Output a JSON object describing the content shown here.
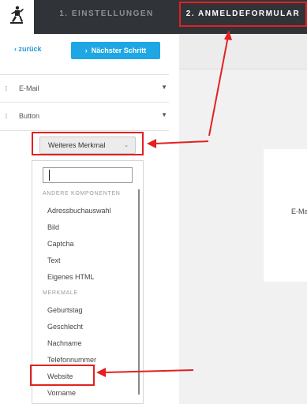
{
  "colors": {
    "accent": "#1ea7e4",
    "topbar": "#303439",
    "annotation": "#e32020"
  },
  "header": {
    "logo_icon": "running-man-icon",
    "tabs": [
      {
        "label": "1. EINSTELLUNGEN"
      },
      {
        "label": "2. ANMELDEFORMULAR",
        "active": true
      }
    ]
  },
  "panel": {
    "back_label": "zurück",
    "next_label": "Nächster Schritt",
    "fields": [
      {
        "label": "E-Mail"
      },
      {
        "label": "Button"
      }
    ],
    "add_button_label": "Weiteres Merkmal",
    "dropdown": {
      "search_value": "",
      "sections": [
        {
          "title": "ANDERE KOMPONENTEN",
          "items": [
            "Adressbuchauswahl",
            "Bild",
            "Captcha",
            "Text",
            "Eigenes HTML"
          ]
        },
        {
          "title": "MERKMALE",
          "items": [
            "Geburtstag",
            "Geschlecht",
            "Nachname",
            "Telefonnummer",
            "Website",
            "Vorname"
          ]
        }
      ]
    }
  },
  "preview": {
    "field_label": "E-Ma"
  }
}
